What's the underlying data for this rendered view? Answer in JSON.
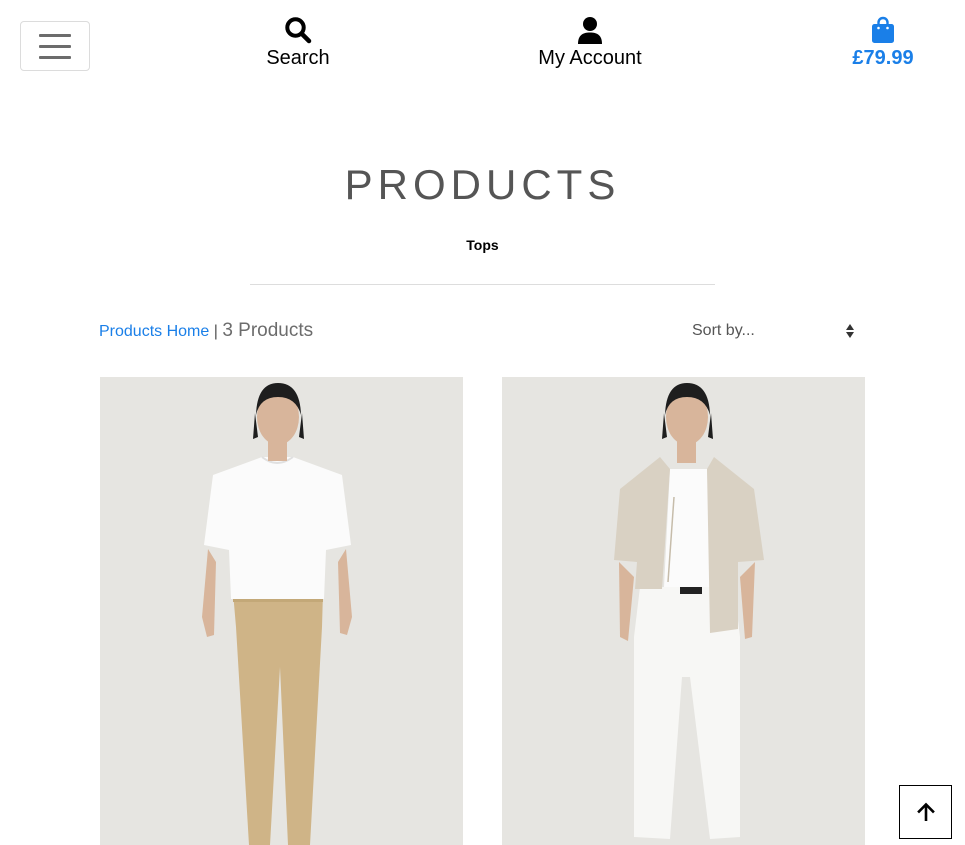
{
  "header": {
    "search_label": "Search",
    "account_label": "My Account",
    "bag_total": "£79.99",
    "accent_color": "#1a7fe8",
    "icons": [
      "menu-icon",
      "search-icon",
      "user-icon",
      "shopping-bag-icon"
    ]
  },
  "page": {
    "title": "PRODUCTS",
    "category": "Tops"
  },
  "toolbar": {
    "breadcrumb_link": "Products Home",
    "separator": "|",
    "product_count": "3 Products",
    "sort_placeholder": "Sort by..."
  },
  "products": [
    {
      "image_desc": "model-white-tshirt-beige-trousers"
    },
    {
      "image_desc": "model-linen-shirt-white-jeans"
    }
  ],
  "back_to_top_icon": "arrow-up-icon"
}
